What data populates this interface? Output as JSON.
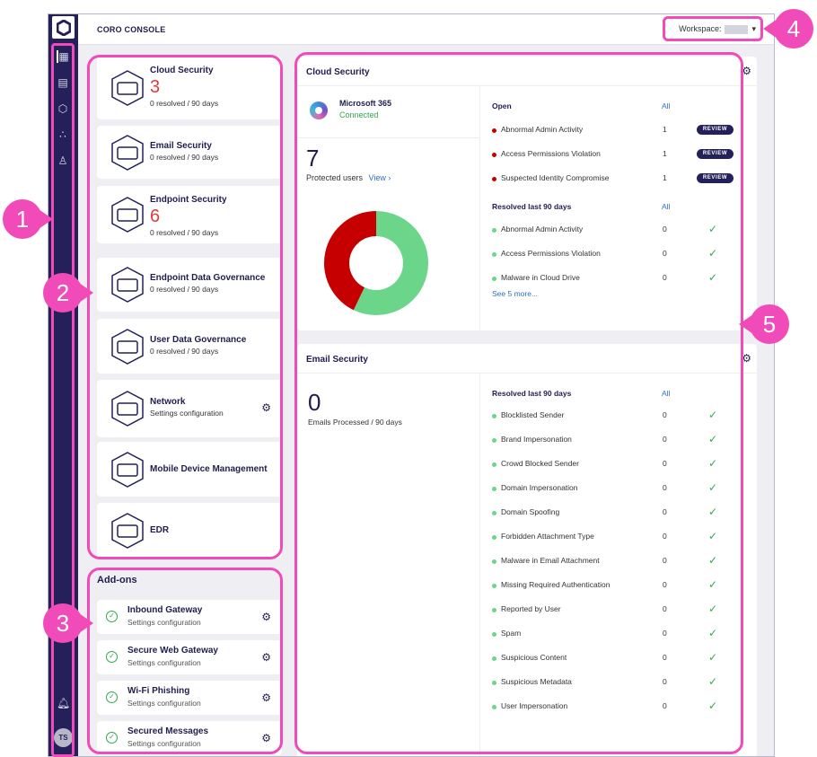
{
  "header": {
    "title": "CORO CONSOLE",
    "workspace_label": "Workspace:"
  },
  "sidebar": {
    "icons": [
      "dashboard-icon",
      "devices-list-icon",
      "settings-icon",
      "connectors-icon",
      "users-icon"
    ],
    "avatar": "TS"
  },
  "modules": [
    {
      "title": "Cloud Security",
      "count": "3",
      "sub": "0 resolved / 90 days",
      "icon": "cloud-icon"
    },
    {
      "title": "Email Security",
      "count": "",
      "sub": "0 resolved / 90 days",
      "icon": "envelope-icon"
    },
    {
      "title": "Endpoint Security",
      "count": "6",
      "sub": "0 resolved / 90 days",
      "icon": "laptop-icon"
    },
    {
      "title": "Endpoint Data Governance",
      "count": "",
      "sub": "0 resolved / 90 days",
      "icon": "document-laptop-icon"
    },
    {
      "title": "User Data Governance",
      "count": "",
      "sub": "0 resolved / 90 days",
      "icon": "file-icon"
    },
    {
      "title": "Network",
      "count": "",
      "sub": "Settings configuration",
      "icon": "network-cloud-icon"
    },
    {
      "title": "Mobile Device Management",
      "count": "",
      "sub": "",
      "icon": "mobile-icon"
    },
    {
      "title": "EDR",
      "count": "",
      "sub": "",
      "icon": "edr-icon"
    }
  ],
  "addons": {
    "title": "Add-ons",
    "items": [
      {
        "title": "Inbound Gateway",
        "sub": "Settings configuration"
      },
      {
        "title": "Secure Web Gateway",
        "sub": "Settings configuration"
      },
      {
        "title": "Wi-Fi Phishing",
        "sub": "Settings configuration"
      },
      {
        "title": "Secured Messages",
        "sub": "Settings configuration"
      }
    ]
  },
  "cloud": {
    "title": "Cloud Security",
    "app": "Microsoft 365",
    "status": "Connected",
    "users": "7",
    "users_label": "Protected users",
    "view": "View ›",
    "open_label": "Open",
    "all": "All",
    "review": "REVIEW",
    "open": [
      {
        "label": "Abnormal Admin Activity",
        "count": "1"
      },
      {
        "label": "Access Permissions Violation",
        "count": "1"
      },
      {
        "label": "Suspected Identity Compromise",
        "count": "1"
      }
    ],
    "resolved_label": "Resolved last 90 days",
    "resolved": [
      {
        "label": "Abnormal Admin Activity",
        "count": "0"
      },
      {
        "label": "Access Permissions Violation",
        "count": "0"
      },
      {
        "label": "Malware in Cloud Drive",
        "count": "0"
      }
    ],
    "see_more": "See 5 more...",
    "donut": {
      "green": 4,
      "red": 3,
      "colors": {
        "green": "#6bd58a",
        "red": "#c60000"
      }
    }
  },
  "email": {
    "title": "Email Security",
    "count": "0",
    "count_label": "Emails Processed / 90 days",
    "resolved_label": "Resolved last 90 days",
    "all": "All",
    "resolved": [
      {
        "label": "Blocklisted Sender",
        "count": "0"
      },
      {
        "label": "Brand Impersonation",
        "count": "0"
      },
      {
        "label": "Crowd Blocked Sender",
        "count": "0"
      },
      {
        "label": "Domain Impersonation",
        "count": "0"
      },
      {
        "label": "Domain Spoofing",
        "count": "0"
      },
      {
        "label": "Forbidden Attachment Type",
        "count": "0"
      },
      {
        "label": "Malware in Email Attachment",
        "count": "0"
      },
      {
        "label": "Missing Required Authentication",
        "count": "0"
      },
      {
        "label": "Reported by User",
        "count": "0"
      },
      {
        "label": "Spam",
        "count": "0"
      },
      {
        "label": "Suspicious Content",
        "count": "0"
      },
      {
        "label": "Suspicious Metadata",
        "count": "0"
      },
      {
        "label": "User Impersonation",
        "count": "0"
      }
    ]
  },
  "callouts": [
    "1",
    "2",
    "3",
    "4",
    "5"
  ],
  "colors": {
    "sidebar": "#24205a",
    "annotation": "#f04bb9",
    "alert": "#e23b3b",
    "ok": "#2fa84f"
  }
}
